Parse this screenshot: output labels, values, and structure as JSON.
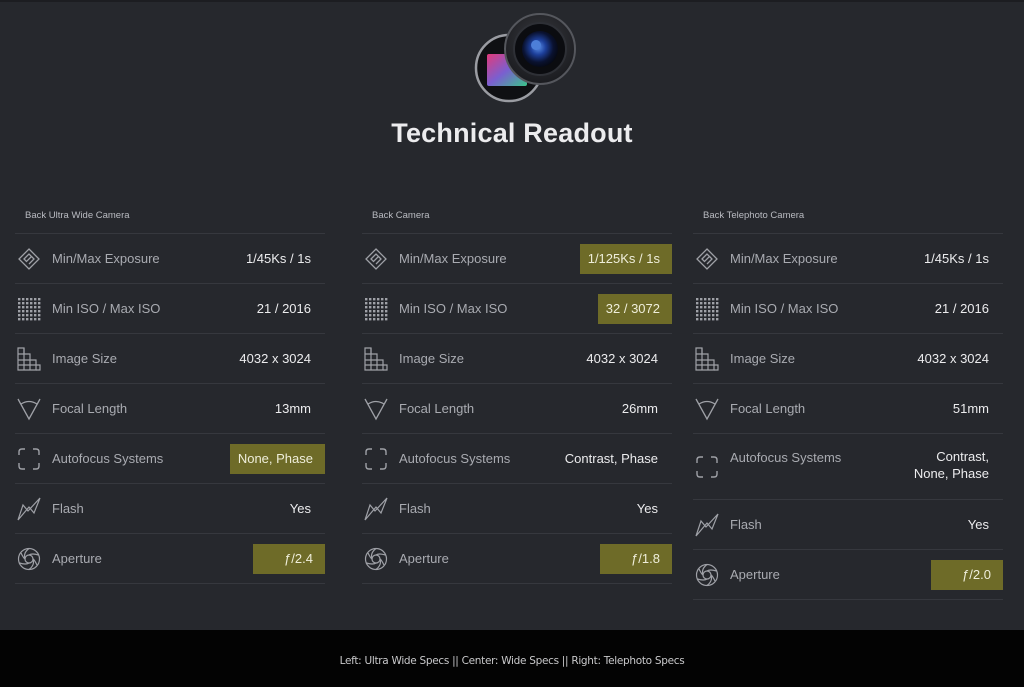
{
  "page": {
    "title": "Technical Readout"
  },
  "colors": {
    "background": "#26282d",
    "highlight": "#6e6b28",
    "footer": "#030303"
  },
  "columns": [
    {
      "heading": "Back Ultra Wide Camera",
      "rows": [
        {
          "icon": "exposure-icon",
          "label": "Min/Max Exposure",
          "value": "1/45Ks / 1s",
          "highlighted": false
        },
        {
          "icon": "iso-grid-icon",
          "label": "Min ISO / Max ISO",
          "value": "21 / 2016",
          "highlighted": false
        },
        {
          "icon": "image-size-icon",
          "label": "Image Size",
          "value": "4032 x 3024",
          "highlighted": false
        },
        {
          "icon": "focal-length-icon",
          "label": "Focal Length",
          "value": "13mm",
          "highlighted": false
        },
        {
          "icon": "autofocus-icon",
          "label": "Autofocus Systems",
          "value": "None, Phase",
          "highlighted": true
        },
        {
          "icon": "flash-icon",
          "label": "Flash",
          "value": "Yes",
          "highlighted": false
        },
        {
          "icon": "aperture-icon",
          "label": "Aperture",
          "value": "ƒ/2.4",
          "highlighted": true
        }
      ]
    },
    {
      "heading": "Back Camera",
      "rows": [
        {
          "icon": "exposure-icon",
          "label": "Min/Max Exposure",
          "value": "1/125Ks / 1s",
          "highlighted": true
        },
        {
          "icon": "iso-grid-icon",
          "label": "Min ISO / Max ISO",
          "value": "32 / 3072",
          "highlighted": true
        },
        {
          "icon": "image-size-icon",
          "label": "Image Size",
          "value": "4032 x 3024",
          "highlighted": false
        },
        {
          "icon": "focal-length-icon",
          "label": "Focal Length",
          "value": "26mm",
          "highlighted": false
        },
        {
          "icon": "autofocus-icon",
          "label": "Autofocus Systems",
          "value": "Contrast, Phase",
          "highlighted": false
        },
        {
          "icon": "flash-icon",
          "label": "Flash",
          "value": "Yes",
          "highlighted": false
        },
        {
          "icon": "aperture-icon",
          "label": "Aperture",
          "value": "ƒ/1.8",
          "highlighted": true
        }
      ]
    },
    {
      "heading": "Back Telephoto Camera",
      "rows": [
        {
          "icon": "exposure-icon",
          "label": "Min/Max Exposure",
          "value": "1/45Ks / 1s",
          "highlighted": false
        },
        {
          "icon": "iso-grid-icon",
          "label": "Min ISO / Max ISO",
          "value": "21 / 2016",
          "highlighted": false
        },
        {
          "icon": "image-size-icon",
          "label": "Image Size",
          "value": "4032 x 3024",
          "highlighted": false
        },
        {
          "icon": "focal-length-icon",
          "label": "Focal Length",
          "value": "51mm",
          "highlighted": false
        },
        {
          "icon": "autofocus-icon",
          "label": "Autofocus Systems",
          "value_lines": [
            "Contrast,",
            "None, Phase"
          ],
          "highlighted": false
        },
        {
          "icon": "flash-icon",
          "label": "Flash",
          "value": "Yes",
          "highlighted": false
        },
        {
          "icon": "aperture-icon",
          "label": "Aperture",
          "value": "ƒ/2.0",
          "highlighted": true
        }
      ]
    }
  ],
  "footer": {
    "caption": "Left: Ultra Wide Specs || Center: Wide Specs || Right: Telephoto Specs"
  }
}
